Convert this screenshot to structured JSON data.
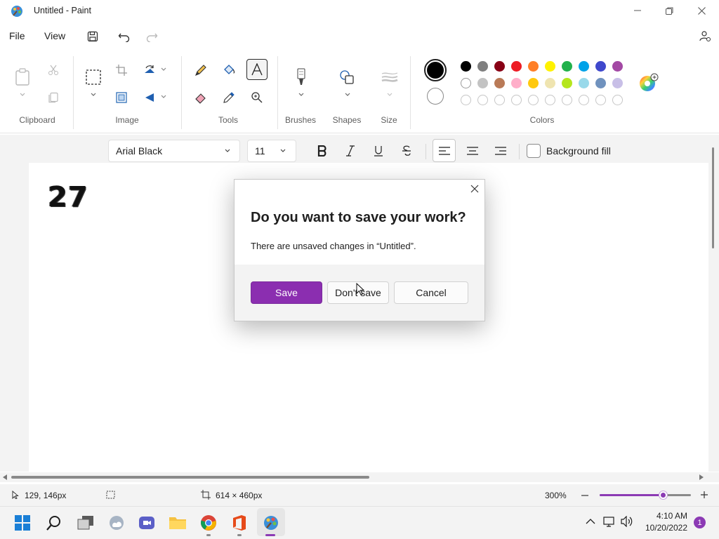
{
  "window": {
    "title": "Untitled - Paint"
  },
  "menu": {
    "file": "File",
    "view": "View"
  },
  "ribbon": {
    "groups": {
      "clipboard": "Clipboard",
      "image": "Image",
      "tools": "Tools",
      "brushes": "Brushes",
      "shapes": "Shapes",
      "size": "Size",
      "colors": "Colors"
    },
    "palette_row1": [
      "#000000",
      "#7f7f7f",
      "#880015",
      "#ed1c24",
      "#ff7f27",
      "#fff200",
      "#22b14c",
      "#00a2e8",
      "#3f48cc",
      "#a349a4"
    ],
    "palette_row2": [
      "#ffffff",
      "#c3c3c3",
      "#b97a57",
      "#ffaec9",
      "#ffc90e",
      "#efe4b0",
      "#b5e61d",
      "#99d9ea",
      "#7092be",
      "#c8bfe7"
    ],
    "primary_color": "#000000",
    "secondary_color": "#ffffff"
  },
  "text_toolbar": {
    "font": "Arial Black",
    "size": "11",
    "background_fill": "Background fill"
  },
  "canvas": {
    "text": "27"
  },
  "status": {
    "cursor": "129, 146px",
    "canvas_size": "614 × 460px",
    "zoom": "300%",
    "zoom_fraction": 0.7
  },
  "dialog": {
    "title": "Do you want to save your work?",
    "message": "There are unsaved changes in “Untitled”.",
    "save": "Save",
    "dont_save": "Don't save",
    "cancel": "Cancel"
  },
  "taskbar": {
    "time": "4:10 AM",
    "date": "10/20/2022",
    "notifications": "1"
  },
  "colors": {
    "accent": "#8c3ab4",
    "accent_button": "#8b2eb0"
  }
}
